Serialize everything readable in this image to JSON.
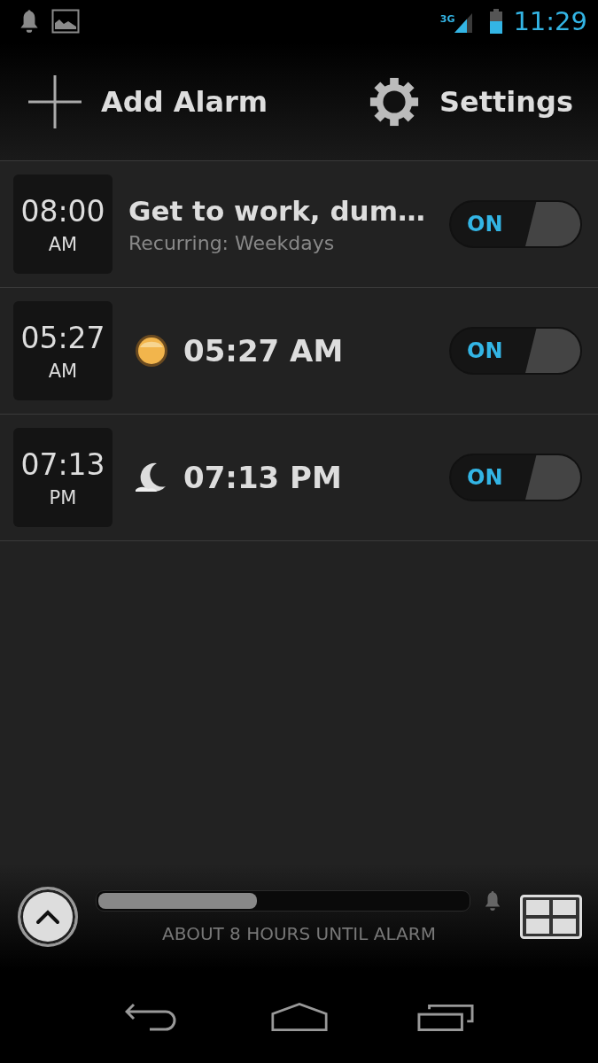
{
  "status_bar": {
    "network": "3G",
    "time": "11:29"
  },
  "toolbar": {
    "add_label": "Add Alarm",
    "settings_label": "Settings"
  },
  "alarms": [
    {
      "kind": "titled",
      "time": "08:00",
      "period": "AM",
      "title": "Get to work, dum…",
      "subtitle": "Recurring: Weekdays",
      "on": true,
      "toggle_label": "ON"
    },
    {
      "kind": "sun",
      "time": "05:27",
      "period": "AM",
      "title": "05:27 AM",
      "on": true,
      "toggle_label": "ON"
    },
    {
      "kind": "moon",
      "time": "07:13",
      "period": "PM",
      "title": "07:13 PM",
      "on": true,
      "toggle_label": "ON"
    }
  ],
  "next_alarm": {
    "level": 0.43,
    "caption": "ABOUT 8 HOURS UNTIL ALARM"
  }
}
